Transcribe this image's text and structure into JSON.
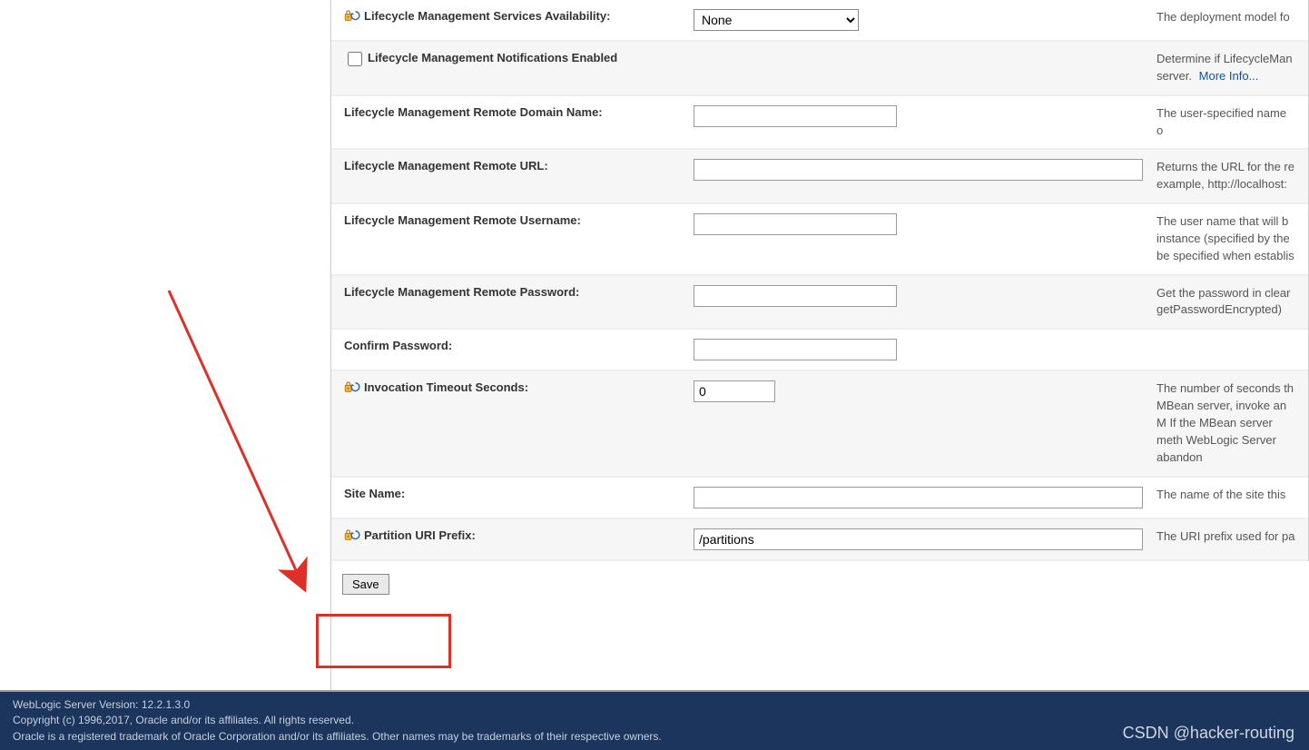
{
  "rows": [
    {
      "label": "Lifecycle Management Services Availability:",
      "icon": true,
      "type": "select",
      "value": "None",
      "options": [
        "None"
      ],
      "desc": "The deployment model fo",
      "alt": false
    },
    {
      "label": "Lifecycle Management Notifications Enabled",
      "icon": false,
      "type": "checkbox",
      "checked": false,
      "desc": "Determine if LifecycleMan server.",
      "more": "More Info...",
      "alt": true
    },
    {
      "label": "Lifecycle Management Remote Domain Name:",
      "icon": false,
      "type": "text-med",
      "value": "",
      "desc": "The user-specified name o",
      "alt": false
    },
    {
      "label": "Lifecycle Management Remote URL:",
      "icon": false,
      "type": "text-wide",
      "value": "",
      "desc": "Returns the URL for the re example, http://localhost:",
      "alt": true
    },
    {
      "label": "Lifecycle Management Remote Username:",
      "icon": false,
      "type": "text-med",
      "value": "",
      "desc": "The user name that will b instance (specified by the be specified when establis",
      "alt": false
    },
    {
      "label": "Lifecycle Management Remote Password:",
      "icon": false,
      "type": "password-med",
      "value": "",
      "desc": "Get the password in clear getPasswordEncrypted)",
      "alt": true
    },
    {
      "label": "Confirm Password:",
      "icon": false,
      "type": "password-med",
      "value": "",
      "desc": "",
      "alt": false
    },
    {
      "label": "Invocation Timeout Seconds:",
      "icon": true,
      "type": "text-sm",
      "value": "0",
      "desc": "The number of seconds th MBean server, invoke an M If the MBean server meth WebLogic Server abandon",
      "alt": true
    },
    {
      "label": "Site Name:",
      "icon": false,
      "type": "text-wide",
      "value": "",
      "desc": "The name of the site this",
      "alt": false
    },
    {
      "label": "Partition URI Prefix:",
      "icon": true,
      "type": "text-wide",
      "value": "/partitions",
      "desc": "The URI prefix used for pa",
      "alt": true
    }
  ],
  "save_label": "Save",
  "footer": {
    "line1": "WebLogic Server Version: 12.2.1.3.0",
    "line2": "Copyright (c) 1996,2017, Oracle and/or its affiliates. All rights reserved.",
    "line3": "Oracle is a registered trademark of Oracle Corporation and/or its affiliates. Other names may be trademarks of their respective owners."
  },
  "watermark": "CSDN @hacker-routing"
}
